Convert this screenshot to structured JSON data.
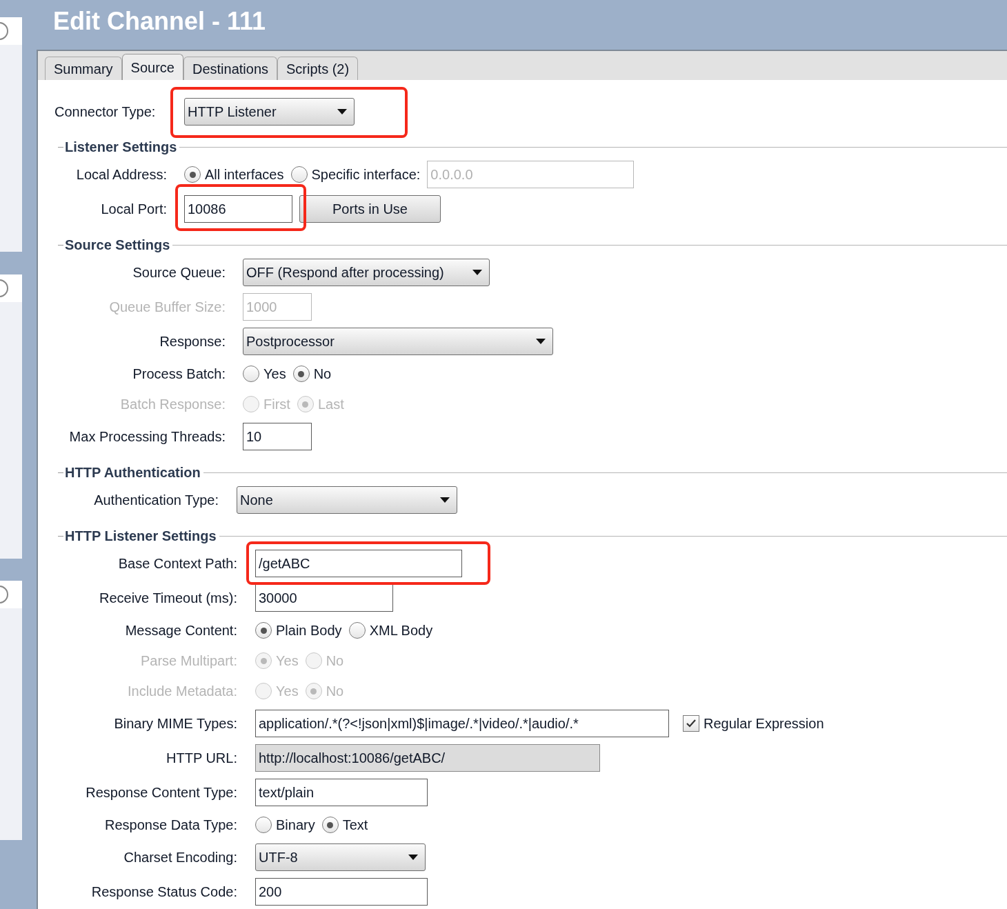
{
  "window": {
    "title": "Edit Channel - 111"
  },
  "tabs": [
    {
      "label": "Summary",
      "selected": false
    },
    {
      "label": "Source",
      "selected": true
    },
    {
      "label": "Destinations",
      "selected": false
    },
    {
      "label": "Scripts (2)",
      "selected": false
    }
  ],
  "connector_type": {
    "label": "Connector Type:",
    "control": {
      "kind": "select",
      "value": "HTTP Listener",
      "highlighted": true
    }
  },
  "sections": [
    {
      "title": "Listener Settings",
      "rows": [
        {
          "label": "Local Address:",
          "disabled": false,
          "controls": [
            {
              "kind": "radio",
              "label": "All interfaces",
              "selected": true
            },
            {
              "kind": "radio",
              "label": "Specific interface:",
              "selected": false
            },
            {
              "kind": "input",
              "value": "0.0.0.0",
              "disabled": true
            }
          ]
        },
        {
          "label": "Local Port:",
          "disabled": false,
          "controls": [
            {
              "kind": "input",
              "value": "10086",
              "highlighted": true
            },
            {
              "kind": "button",
              "label": "Ports in Use"
            }
          ]
        }
      ]
    },
    {
      "title": "Source Settings",
      "rows": [
        {
          "label": "Source Queue:",
          "disabled": false,
          "controls": [
            {
              "kind": "select",
              "value": "OFF (Respond after processing)"
            }
          ]
        },
        {
          "label": "Queue Buffer Size:",
          "disabled": true,
          "controls": [
            {
              "kind": "input",
              "value": "1000",
              "disabled": true
            }
          ]
        },
        {
          "label": "Response:",
          "disabled": false,
          "controls": [
            {
              "kind": "select",
              "value": "Postprocessor"
            }
          ]
        },
        {
          "label": "Process Batch:",
          "disabled": false,
          "controls": [
            {
              "kind": "radio",
              "label": "Yes",
              "selected": false
            },
            {
              "kind": "radio",
              "label": "No",
              "selected": true
            }
          ]
        },
        {
          "label": "Batch Response:",
          "disabled": true,
          "controls": [
            {
              "kind": "radio",
              "label": "First",
              "selected": false
            },
            {
              "kind": "radio",
              "label": "Last",
              "selected": true
            }
          ]
        },
        {
          "label": "Max Processing Threads:",
          "disabled": false,
          "controls": [
            {
              "kind": "input",
              "value": "10"
            }
          ]
        }
      ]
    },
    {
      "title": "HTTP Authentication",
      "rows": [
        {
          "label": "Authentication Type:",
          "disabled": false,
          "controls": [
            {
              "kind": "select",
              "value": "None"
            }
          ]
        }
      ]
    },
    {
      "title": "HTTP Listener Settings",
      "rows": [
        {
          "label": "Base Context Path:",
          "disabled": false,
          "controls": [
            {
              "kind": "input",
              "value": "/getABC",
              "highlighted": true
            }
          ]
        },
        {
          "label": "Receive Timeout (ms):",
          "disabled": false,
          "controls": [
            {
              "kind": "input",
              "value": "30000"
            }
          ]
        },
        {
          "label": "Message Content:",
          "disabled": false,
          "controls": [
            {
              "kind": "radio",
              "label": "Plain Body",
              "selected": true
            },
            {
              "kind": "radio",
              "label": "XML Body",
              "selected": false
            }
          ]
        },
        {
          "label": "Parse Multipart:",
          "disabled": true,
          "controls": [
            {
              "kind": "radio",
              "label": "Yes",
              "selected": true
            },
            {
              "kind": "radio",
              "label": "No",
              "selected": false
            }
          ]
        },
        {
          "label": "Include Metadata:",
          "disabled": true,
          "controls": [
            {
              "kind": "radio",
              "label": "Yes",
              "selected": false
            },
            {
              "kind": "radio",
              "label": "No",
              "selected": true
            }
          ]
        },
        {
          "label": "Binary MIME Types:",
          "disabled": false,
          "controls": [
            {
              "kind": "input",
              "value": "application/.*(?<!json|xml)$|image/.*|video/.*|audio/.*"
            },
            {
              "kind": "checkbox",
              "label": "Regular Expression",
              "checked": true
            }
          ]
        },
        {
          "label": "HTTP URL:",
          "disabled": false,
          "controls": [
            {
              "kind": "input",
              "value": "http://localhost:10086/getABC/",
              "readonly": true
            }
          ]
        },
        {
          "label": "Response Content Type:",
          "disabled": false,
          "controls": [
            {
              "kind": "input",
              "value": "text/plain"
            }
          ]
        },
        {
          "label": "Response Data Type:",
          "disabled": false,
          "controls": [
            {
              "kind": "radio",
              "label": "Binary",
              "selected": false
            },
            {
              "kind": "radio",
              "label": "Text",
              "selected": true
            }
          ]
        },
        {
          "label": "Charset Encoding:",
          "disabled": false,
          "controls": [
            {
              "kind": "select",
              "value": "UTF-8"
            }
          ]
        },
        {
          "label": "Response Status Code:",
          "disabled": false,
          "controls": [
            {
              "kind": "input",
              "value": "200"
            }
          ]
        }
      ]
    }
  ]
}
